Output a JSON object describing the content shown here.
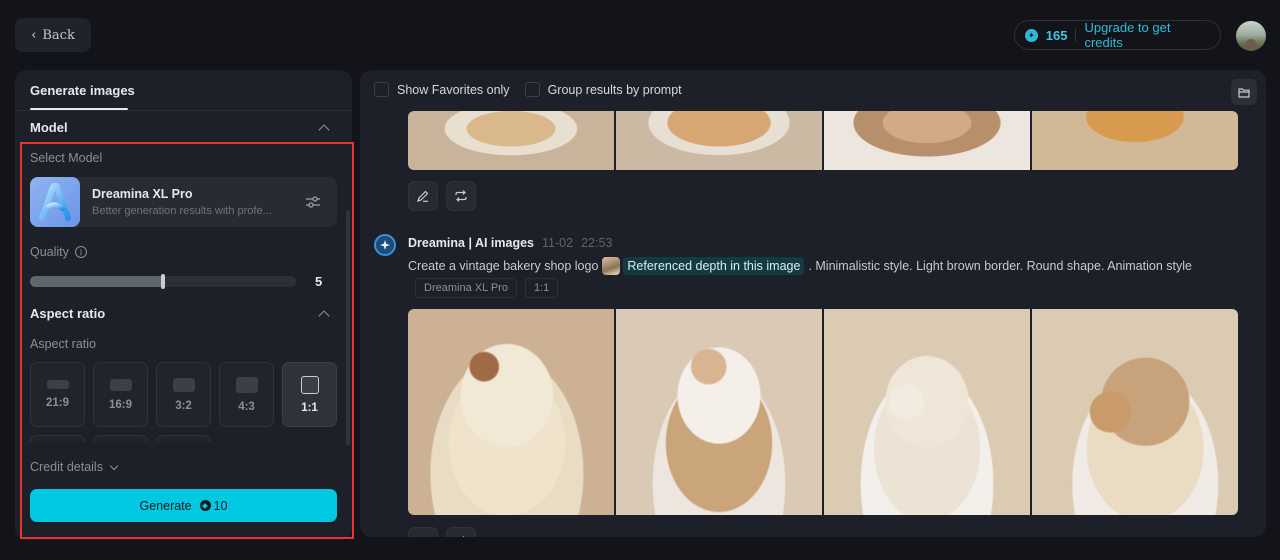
{
  "header": {
    "back_label": "Back",
    "credits_count": "165",
    "upgrade_label": "Upgrade to get credits"
  },
  "left_panel": {
    "tab_label": "Generate images",
    "model_section_title": "Model",
    "select_model_label": "Select Model",
    "model": {
      "name": "Dreamina XL Pro",
      "description": "Better generation results with profe..."
    },
    "quality": {
      "label": "Quality",
      "value": "5",
      "fraction": 0.5
    },
    "aspect_section_title": "Aspect ratio",
    "aspect_label": "Aspect ratio",
    "aspect_ratios": [
      {
        "label": "21:9",
        "selected": false
      },
      {
        "label": "16:9",
        "selected": false
      },
      {
        "label": "3:2",
        "selected": false
      },
      {
        "label": "4:3",
        "selected": false
      },
      {
        "label": "1:1",
        "selected": true
      }
    ],
    "credit_details_label": "Credit details",
    "generate": {
      "label": "Generate",
      "cost": "10"
    }
  },
  "results": {
    "filters": {
      "favorites_label": "Show Favorites only",
      "group_label": "Group results by prompt"
    },
    "message": {
      "author": "Dreamina | AI images",
      "date": "11-02",
      "time": "22:53",
      "prompt_before": "Create a vintage bakery shop logo",
      "reference_chip": "Referenced depth in this image",
      "prompt_after": ". Minimalistic style. Light brown border. Round shape. Animation style",
      "tags": [
        "Dreamina XL Pro",
        "1:1"
      ]
    }
  }
}
